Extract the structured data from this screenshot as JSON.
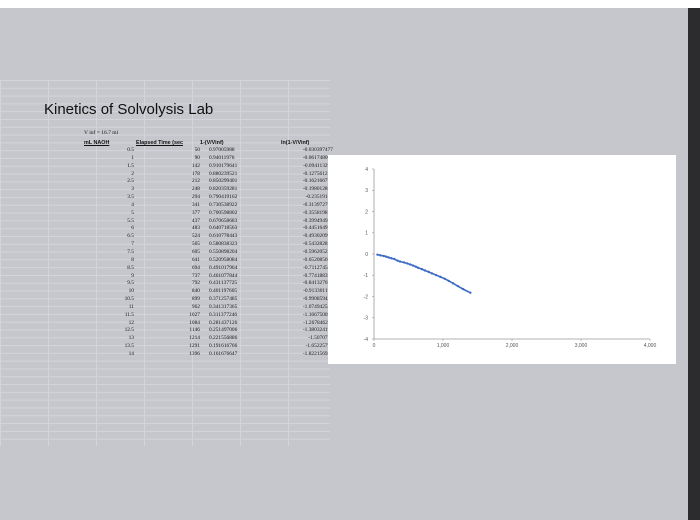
{
  "sheet": {
    "title": "Kinetics of Solvolysis Lab",
    "vinf_label": "V inf = 16.7 ml",
    "headers": [
      "mL NAOH",
      "Elapsed Time (sec",
      "1-(V/Vinf)",
      "ln(1-V/Vinf)"
    ],
    "rows": [
      [
        "0.5",
        "50",
        "0.97005988",
        "-0.030397477"
      ],
      [
        "1",
        "90",
        "0.94011976",
        "-0.061748007"
      ],
      [
        "1.5",
        "142",
        "0.910179641",
        "-0.094113292"
      ],
      [
        "2",
        "178",
        "0.880239521",
        "-0.127561226"
      ],
      [
        "2.5",
        "212",
        "0.850299401",
        "-0.162166755"
      ],
      [
        "3",
        "248",
        "0.820359281",
        "-0.198012887"
      ],
      [
        "3.5",
        "294",
        "0.790419162",
        "-0.23519189"
      ],
      [
        "4",
        "341",
        "0.730538922",
        "-0.313972768"
      ],
      [
        "5",
        "377",
        "0.700598802",
        "-0.355819878"
      ],
      [
        "5.5",
        "437",
        "0.670658683",
        "-0.399494941"
      ],
      [
        "6",
        "483",
        "0.640718563",
        "-0.445164978"
      ],
      [
        "6.5",
        "524",
        "0.610778443",
        "-0.493020999"
      ],
      [
        "7",
        "565",
        "0.580838323",
        "-0.543282834"
      ],
      [
        "7.5",
        "605",
        "0.550898204",
        "-0.596205235"
      ],
      [
        "8",
        "641",
        "0.520958084",
        "-0.652085694"
      ],
      [
        "8.5",
        "694",
        "0.491017964",
        "-0.711274565"
      ],
      [
        "9",
        "737",
        "0.461077844",
        "-0.774188391"
      ],
      [
        "9.5",
        "792",
        "0.431137725",
        "-0.841327693"
      ],
      [
        "10",
        "840",
        "0.401197605",
        "-0.913301193"
      ],
      [
        "10.5",
        "899",
        "0.371257485",
        "-0.990859427"
      ],
      [
        "11",
        "962",
        "0.341317365",
        "-1.074942545"
      ],
      [
        "11.5",
        "1027",
        "0.311377246",
        "-1.166750094"
      ],
      [
        "12",
        "1084",
        "0.281437126",
        "-1.267846211"
      ],
      [
        "12.5",
        "1146",
        "0.251497006",
        "-1.380324194"
      ],
      [
        "13",
        "1214",
        "0.221556886",
        "-1.5070759"
      ],
      [
        "13.5",
        "1291",
        "0.191616766",
        "-1.65225791"
      ],
      [
        "14",
        "1396",
        "0.161676647",
        "-1.822156946"
      ]
    ]
  },
  "chart_data": {
    "type": "line",
    "title": "",
    "xlabel": "",
    "ylabel": "",
    "xlim": [
      0,
      4000
    ],
    "ylim": [
      -4,
      4
    ],
    "x_ticks": [
      "0",
      "1,000",
      "2,000",
      "3,000",
      "4,000"
    ],
    "y_ticks": [
      "4",
      "3",
      "2",
      "1",
      "0",
      "-1",
      "-2",
      "-3",
      "-4"
    ],
    "x_tick_values": [
      0,
      1000,
      2000,
      3000,
      4000
    ],
    "y_tick_values": [
      4,
      3,
      2,
      1,
      0,
      -1,
      -2,
      -3,
      -4
    ],
    "grid": false,
    "line_color": "#3c6bc4",
    "x": [
      50,
      90,
      142,
      178,
      212,
      248,
      294,
      341,
      377,
      437,
      483,
      524,
      565,
      605,
      641,
      694,
      737,
      792,
      840,
      899,
      962,
      1027,
      1084,
      1146,
      1214,
      1291,
      1396
    ],
    "y": [
      -0.030397477,
      -0.061748007,
      -0.094113292,
      -0.127561226,
      -0.162166755,
      -0.198012887,
      -0.23519189,
      -0.313972768,
      -0.355819878,
      -0.399494941,
      -0.445164978,
      -0.493020999,
      -0.543282834,
      -0.596205235,
      -0.652085694,
      -0.711274565,
      -0.774188391,
      -0.841327693,
      -0.913301193,
      -0.990859427,
      -1.074942545,
      -1.166750094,
      -1.267846211,
      -1.380324194,
      -1.5070759,
      -1.65225791,
      -1.822156946
    ]
  }
}
